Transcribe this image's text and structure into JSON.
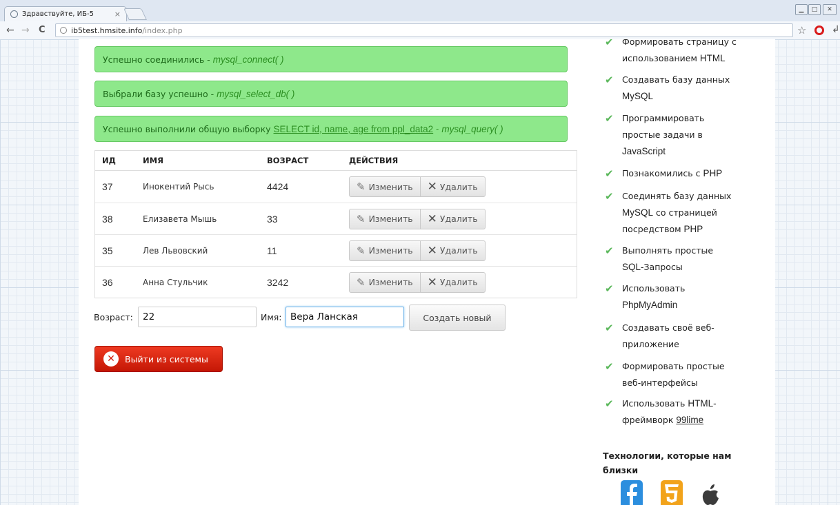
{
  "browser": {
    "tab_title": "Здравствуйте, ИБ-5",
    "tab_close": "×",
    "url_host": "ib5test.hmsite.info",
    "url_path": "/index.php",
    "back": "←",
    "forward": "→",
    "reload": "C",
    "bookmark_star": "☆",
    "wrench": "↲"
  },
  "alerts": [
    {
      "text": "Успешно соединились -",
      "fn": "mysql_connect( )"
    },
    {
      "text": "Выбрали базу успешно -",
      "fn": "mysql_select_db( )"
    },
    {
      "text": "Успешно выполнили общую выборку",
      "sql": "SELECT id, name, age from ppl_data2",
      "sep": "-",
      "fn": "mysql_query( )"
    }
  ],
  "table": {
    "headers": [
      "ИД",
      "ИМЯ",
      "ВОЗРАСТ",
      "ДЕЙСТВИЯ"
    ],
    "rows": [
      {
        "id": "37",
        "name": "Инокентий Рысь",
        "age": "4424"
      },
      {
        "id": "38",
        "name": "Елизавета Мышь",
        "age": "33"
      },
      {
        "id": "35",
        "name": "Лев Львовский",
        "age": "11"
      },
      {
        "id": "36",
        "name": "Анна Стульчик",
        "age": "3242"
      }
    ],
    "edit_label": "Изменить",
    "delete_label": "Удалить"
  },
  "form": {
    "age_label": "Возраст:",
    "age_value": "22",
    "name_label": "Имя:",
    "name_value": "Вера Ланская",
    "create_label": "Создать новый"
  },
  "logout_label": "Выйти из системы",
  "sidebar": {
    "skills": [
      {
        "text": "Формировать страницу с",
        "text2": "использованием",
        "latin": "HTML"
      },
      {
        "text": "Создавать базу данных",
        "latin": "MySQL"
      },
      {
        "text": "Программировать простые задачи в",
        "latin": "JavaScript"
      },
      {
        "text": "Познакомились с",
        "latin": "PHP"
      },
      {
        "text": "Соединять базу данных",
        "latin": "MySQL",
        "text2": "со страницей посредством",
        "latin2": "PHP"
      },
      {
        "text": "Выполнять простые",
        "latin": "SQL",
        "text2": "-Запросы"
      },
      {
        "text": "Использовать",
        "latin": "PhpMyAdmin"
      },
      {
        "text": "Создавать своё веб-приложение"
      },
      {
        "text": "Формировать простые веб-интерфейсы"
      },
      {
        "text": "Использовать",
        "latin": "HTML-",
        "text2": "фреймворк",
        "link": "99lime"
      }
    ],
    "tech_heading": "Технологии, которые нам близки"
  },
  "colors": {
    "alert_bg": "#8ee88b",
    "check": "#5cb85c",
    "logout_bg": "#d9230f",
    "facebook": "#2c8ede",
    "html5": "#f2a31b"
  }
}
